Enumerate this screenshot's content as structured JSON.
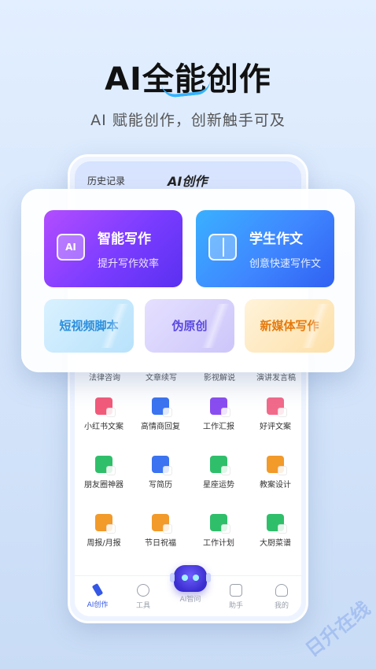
{
  "hero": {
    "title": "AI全能创作",
    "subtitle": "AI 赋能创作，创新触手可及"
  },
  "phone": {
    "history_label": "历史记录",
    "app_title": "AI创作",
    "cut_row": [
      "法律咨询",
      "文章续写",
      "影视解说",
      "演讲发言稿"
    ],
    "tools": [
      {
        "label": "小红书文案",
        "icon": "note-icon",
        "color": "#f25a7a"
      },
      {
        "label": "高情商回复",
        "icon": "chat-icon",
        "color": "#3b73f0"
      },
      {
        "label": "工作汇报",
        "icon": "briefcase-icon",
        "color": "#8a4df0"
      },
      {
        "label": "好评文案",
        "icon": "heart-doc-icon",
        "color": "#f26a8a"
      },
      {
        "label": "朋友圈神器",
        "icon": "share-doc-icon",
        "color": "#2fbf6a"
      },
      {
        "label": "写简历",
        "icon": "resume-icon",
        "color": "#3b73f0"
      },
      {
        "label": "星座运势",
        "icon": "star-icon",
        "color": "#2fbf6a"
      },
      {
        "label": "教案设计",
        "icon": "lesson-icon",
        "color": "#f29a2a"
      },
      {
        "label": "周报/月报",
        "icon": "report-icon",
        "color": "#f29a2a"
      },
      {
        "label": "节日祝福",
        "icon": "gift-icon",
        "color": "#f29a2a"
      },
      {
        "label": "工作计划",
        "icon": "plan-icon",
        "color": "#2fbf6a"
      },
      {
        "label": "大厨菜谱",
        "icon": "recipe-icon",
        "color": "#2fbf6a"
      }
    ],
    "tabbar": {
      "ai_create": "AI创作",
      "tools": "工具",
      "ai_ask": "AI智问",
      "assistant": "助手",
      "mine": "我的"
    }
  },
  "panel": {
    "writing": {
      "title": "智能写作",
      "subtitle": "提升写作效率",
      "icon_text": "AI"
    },
    "essay": {
      "title": "学生作文",
      "subtitle": "创意快速写作文"
    },
    "short_video": "短视频脚本",
    "pseudo_original": "伪原创",
    "new_media": "新媒体写作"
  },
  "watermark": "日升在线"
}
